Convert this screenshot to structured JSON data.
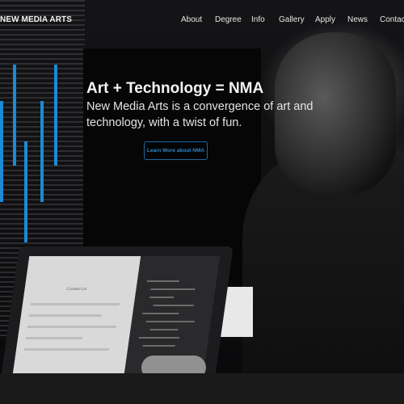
{
  "header": {
    "brand": "NEW MEDIA ARTS",
    "nav": [
      "About",
      "Degree",
      "Info",
      "Gallery",
      "Apply",
      "News",
      "Contact"
    ]
  },
  "hero": {
    "headline": "Art + Technology = NMA",
    "tagline": "New Media Arts is a convergence of art and technology, with a twist of fun.",
    "cta_label": "Learn More about NMA"
  },
  "laptop": {
    "page_title": "Contact Us"
  },
  "colors": {
    "accent": "#1c8ad6",
    "background": "#0b0b0d",
    "text": "#f4f4f4"
  }
}
